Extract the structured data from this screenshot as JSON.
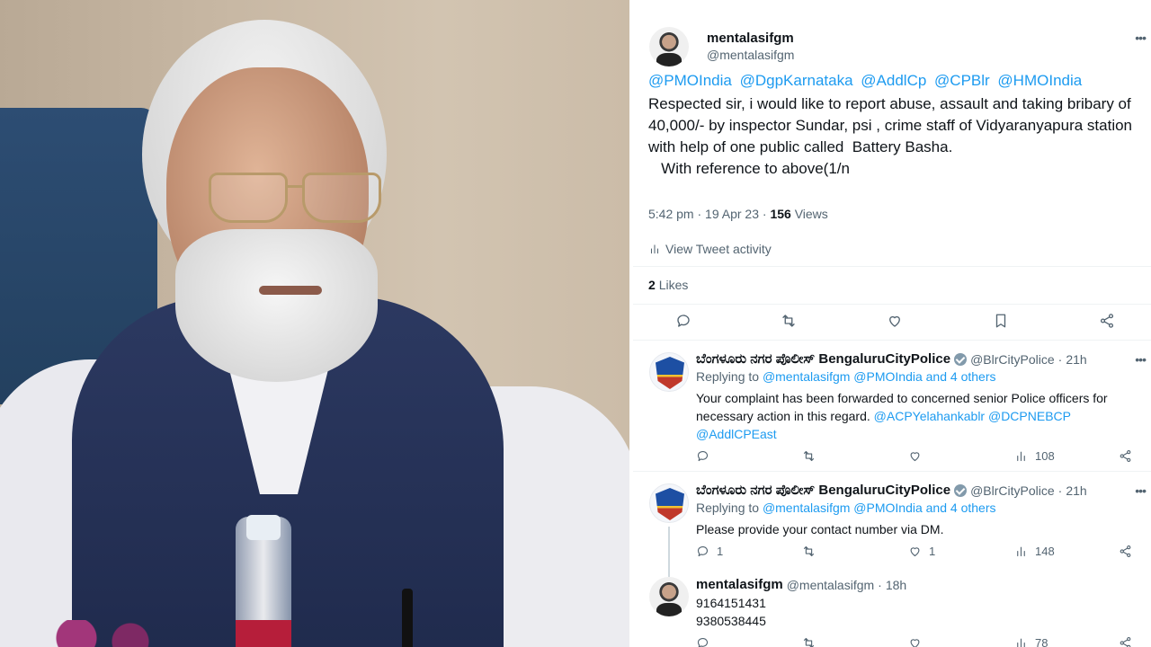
{
  "main_tweet": {
    "display_name": "mentalasifgm",
    "handle": "@mentalasifgm",
    "mentions": [
      "@PMOIndia",
      "@DgpKarnataka",
      "@AddlCp",
      "@CPBlr",
      "@HMOIndia"
    ],
    "body": "Respected sir, i would like to report abuse, assault and taking bribary of 40,000/- by inspector Sundar, psi , crime staff of Vidyaranyapura station with help of one public called  Battery Basha.\n   With reference to above(1/n",
    "time": "5:42 pm",
    "date": "19 Apr 23",
    "views_count": "156",
    "views_label": "Views",
    "activity_label": "View Tweet activity",
    "likes_count": "2",
    "likes_label": "Likes"
  },
  "replies": [
    {
      "display_name": "ಬೆಂಗಳೂರು ನಗರ ಪೊಲೀಸ್ BengaluruCityPolice",
      "handle": "@BlrCityPolice",
      "age": "21h",
      "replying_prefix": "Replying to",
      "replying_targets": "@mentalasifgm @PMOIndia and 4 others",
      "text": "Your complaint has been forwarded to concerned senior Police officers for necessary action in this regard.",
      "text_mentions": "@ACPYelahankablr @DCPNEBCP @AddlCPEast",
      "reply_count": "",
      "retweet_count": "",
      "like_count": "",
      "views": "108"
    },
    {
      "display_name": "ಬೆಂಗಳೂರು ನಗರ ಪೊಲೀಸ್ BengaluruCityPolice",
      "handle": "@BlrCityPolice",
      "age": "21h",
      "replying_prefix": "Replying to",
      "replying_targets": "@mentalasifgm @PMOIndia and 4 others",
      "text": "Please provide your contact number via DM.",
      "text_mentions": "",
      "reply_count": "1",
      "retweet_count": "",
      "like_count": "1",
      "views": "148"
    },
    {
      "display_name": "mentalasifgm",
      "handle": "@mentalasifgm",
      "age": "18h",
      "line1": "9164151431",
      "line2": "9380538445",
      "views": "78"
    }
  ],
  "colors": {
    "accent": "#1d9bf0",
    "muted": "#536471",
    "text": "#0f1419"
  }
}
